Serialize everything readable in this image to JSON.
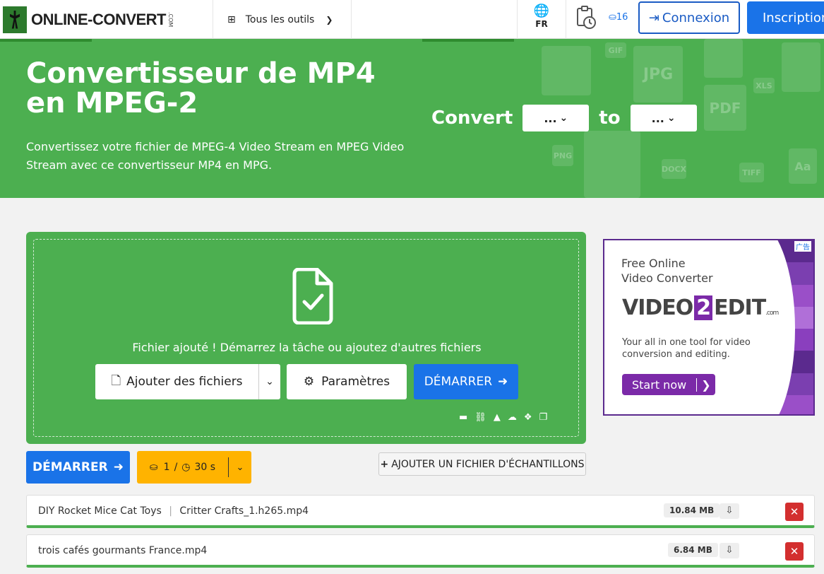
{
  "header": {
    "logo_text": "ONLINE-CONVERT",
    "logo_suffix": ".COM",
    "tools_label": "Tous les outils",
    "lang": "FR",
    "credits": "16",
    "login_label": "Connexion",
    "signup_label": "Inscription"
  },
  "hero": {
    "title": "Convertisseur de MP4 en MPEG-2",
    "subtitle": "Convertissez votre fichier de MPEG-4 Video Stream en MPEG Video Stream avec ce convertisseur MP4 en MPG.",
    "convert_label": "Convert",
    "from_value": "...",
    "to_label": "to",
    "to_value": "...",
    "deco_labels": [
      "GIF",
      "JPG",
      "PDF",
      "XLS",
      "PNG",
      "DOCX",
      "TIFF",
      "Aa"
    ]
  },
  "upload": {
    "message": "Fichier ajouté ! Démarrez la tâche ou ajoutez d'autres fichiers",
    "add_label": "Ajouter des fichiers",
    "params_label": "Paramètres",
    "start_label": "DÉMARRER"
  },
  "actions": {
    "start_label": "DÉMARRER",
    "cost_credits": "1",
    "cost_sep": "/",
    "cost_time": "30 s",
    "sample_label": "AJOUTER UN FICHIER D'ÉCHANTILLONS"
  },
  "files": [
    {
      "name": "DIY Rocket Mice Cat Toys",
      "sep": "|",
      "name2": "Critter Crafts_1.h265.mp4",
      "size": "10.84 MB"
    },
    {
      "name": "trois cafés gourmants France.mp4",
      "size": "6.84 MB"
    }
  ],
  "ad": {
    "tag": "广告",
    "line1": "Free Online",
    "line2": "Video Converter",
    "logo_left": "VIDEO",
    "logo_mid": "2",
    "logo_right": "EDIT",
    "logo_com": ".com",
    "desc1": "Your all in one tool for video",
    "desc2": "conversion and editing.",
    "cta": "Start now",
    "stripe_colors": [
      "#5b2a8e",
      "#7b3fb0",
      "#9a4fc8",
      "#b06fd8",
      "#8a3fbe",
      "#5b2a8e",
      "#7b3fb0",
      "#9a4fc8"
    ]
  },
  "colors": {
    "green": "#4caf50",
    "blue": "#1a73e8",
    "orange": "#ffb300",
    "red": "#d32f2f"
  }
}
